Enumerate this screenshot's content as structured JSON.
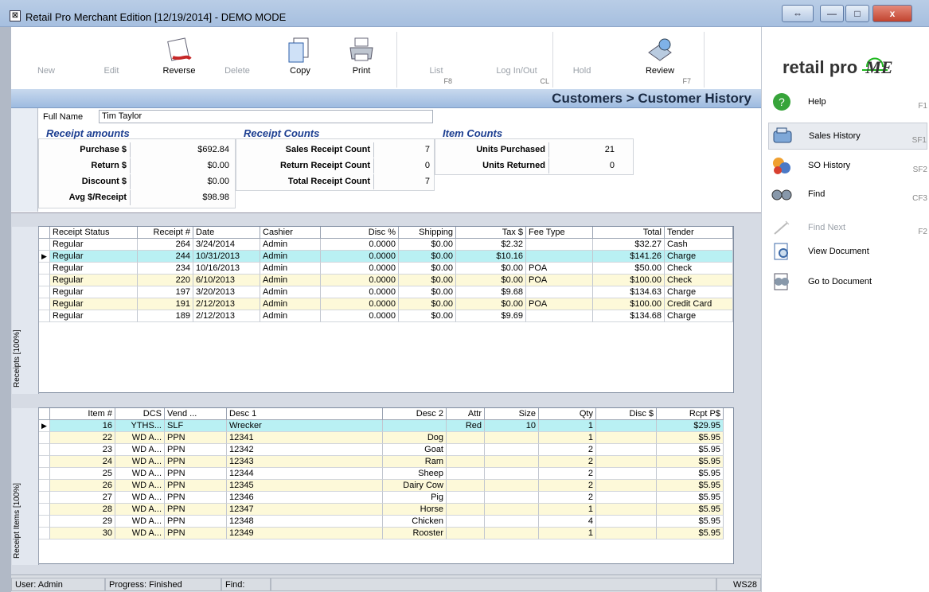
{
  "window": {
    "title": "Retail Pro Merchant Edition [12/19/2014] - DEMO MODE",
    "controls": [
      "⇔",
      "—",
      "□",
      "x"
    ]
  },
  "toolbar": [
    {
      "label": "New",
      "enabled": false,
      "fkey": ""
    },
    {
      "label": "Edit",
      "enabled": false,
      "fkey": ""
    },
    {
      "label": "Reverse",
      "enabled": true,
      "fkey": ""
    },
    {
      "label": "Delete",
      "enabled": false,
      "fkey": ""
    },
    {
      "label": "Copy",
      "enabled": true,
      "fkey": ""
    },
    {
      "label": "Print",
      "enabled": true,
      "fkey": ""
    },
    {
      "label": "List",
      "enabled": false,
      "fkey": "F8"
    },
    {
      "label": "Log In/Out",
      "enabled": false,
      "fkey": "CL"
    },
    {
      "label": "Hold",
      "enabled": false,
      "fkey": ""
    },
    {
      "label": "Review",
      "enabled": true,
      "fkey": "F7"
    }
  ],
  "logo": {
    "text": "retail pro",
    "suffix": "ME"
  },
  "breadcrumb": "Customers > Customer History",
  "customer": {
    "label": "Full Name",
    "value": "Tim Taylor"
  },
  "receipt_amounts": {
    "title": "Receipt amounts",
    "rows": [
      {
        "label": "Purchase $",
        "value": "$692.84"
      },
      {
        "label": "Return $",
        "value": "$0.00"
      },
      {
        "label": "Discount $",
        "value": "$0.00"
      },
      {
        "label": "Avg $/Receipt",
        "value": "$98.98"
      }
    ]
  },
  "receipt_counts": {
    "title": "Receipt Counts",
    "rows": [
      {
        "label": "Sales Receipt Count",
        "value": "7"
      },
      {
        "label": "Return Receipt Count",
        "value": "0"
      },
      {
        "label": "Total Receipt Count",
        "value": "7"
      }
    ]
  },
  "item_counts": {
    "title": "Item Counts",
    "rows": [
      {
        "label": "Units Purchased",
        "value": "21"
      },
      {
        "label": "Units Returned",
        "value": "0"
      }
    ]
  },
  "receipts": {
    "tab": "Receipts [100%]",
    "columns": [
      "Receipt Status",
      "Receipt #",
      "Date",
      "Cashier",
      "Disc %",
      "Shipping",
      "Tax $",
      "Fee Type",
      "Total",
      "Tender"
    ],
    "rows": [
      [
        "Regular",
        "264",
        "3/24/2014",
        "Admin",
        "0.0000",
        "$0.00",
        "$2.32",
        "",
        "$32.27",
        "Cash"
      ],
      [
        "Regular",
        "244",
        "10/31/2013",
        "Admin",
        "0.0000",
        "$0.00",
        "$10.16",
        "",
        "$141.26",
        "Charge"
      ],
      [
        "Regular",
        "234",
        "10/16/2013",
        "Admin",
        "0.0000",
        "$0.00",
        "$0.00",
        "POA",
        "$50.00",
        "Check"
      ],
      [
        "Regular",
        "220",
        "6/10/2013",
        "Admin",
        "0.0000",
        "$0.00",
        "$0.00",
        "POA",
        "$100.00",
        "Check"
      ],
      [
        "Regular",
        "197",
        "3/20/2013",
        "Admin",
        "0.0000",
        "$0.00",
        "$9.68",
        "",
        "$134.63",
        "Charge"
      ],
      [
        "Regular",
        "191",
        "2/12/2013",
        "Admin",
        "0.0000",
        "$0.00",
        "$0.00",
        "POA",
        "$100.00",
        "Credit Card"
      ],
      [
        "Regular",
        "189",
        "2/12/2013",
        "Admin",
        "0.0000",
        "$0.00",
        "$9.69",
        "",
        "$134.68",
        "Charge"
      ]
    ],
    "selected": 1
  },
  "items": {
    "tab": "Receipt Items [100%]",
    "columns": [
      "Item #",
      "DCS",
      "Vend ...",
      "Desc 1",
      "Desc 2",
      "Attr",
      "Size",
      "Qty",
      "Disc $",
      "Rcpt P$"
    ],
    "rows": [
      [
        "16",
        "YTHS...",
        "SLF",
        "Wrecker",
        "",
        "Red",
        "10",
        "1",
        "",
        "$29.95"
      ],
      [
        "22",
        "WD A...",
        "PPN",
        "12341",
        "Dog",
        "",
        "",
        "1",
        "",
        "$5.95"
      ],
      [
        "23",
        "WD A...",
        "PPN",
        "12342",
        "Goat",
        "",
        "",
        "2",
        "",
        "$5.95"
      ],
      [
        "24",
        "WD A...",
        "PPN",
        "12343",
        "Ram",
        "",
        "",
        "2",
        "",
        "$5.95"
      ],
      [
        "25",
        "WD A...",
        "PPN",
        "12344",
        "Sheep",
        "",
        "",
        "2",
        "",
        "$5.95"
      ],
      [
        "26",
        "WD A...",
        "PPN",
        "12345",
        "Dairy Cow",
        "",
        "",
        "2",
        "",
        "$5.95"
      ],
      [
        "27",
        "WD A...",
        "PPN",
        "12346",
        "Pig",
        "",
        "",
        "2",
        "",
        "$5.95"
      ],
      [
        "28",
        "WD A...",
        "PPN",
        "12347",
        "Horse",
        "",
        "",
        "1",
        "",
        "$5.95"
      ],
      [
        "29",
        "WD A...",
        "PPN",
        "12348",
        "Chicken",
        "",
        "",
        "4",
        "",
        "$5.95"
      ],
      [
        "30",
        "WD A...",
        "PPN",
        "12349",
        "Rooster",
        "",
        "",
        "1",
        "",
        "$5.95"
      ]
    ],
    "selected": 0
  },
  "sidebar": [
    {
      "label": "Help",
      "key": "F1",
      "icon": "help-icon",
      "enabled": true
    },
    {
      "label": "Sales History",
      "key": "SF1",
      "icon": "sales-history-icon",
      "enabled": true
    },
    {
      "label": "SO History",
      "key": "SF2",
      "icon": "so-history-icon",
      "enabled": true
    },
    {
      "label": "Find",
      "key": "CF3",
      "icon": "binoculars-icon",
      "enabled": true
    },
    {
      "label": "Find Next",
      "key": "F2",
      "icon": "find-next-icon",
      "enabled": false
    },
    {
      "label": "View Document",
      "key": "",
      "icon": "view-document-icon",
      "enabled": true
    },
    {
      "label": "Go to Document",
      "key": "",
      "icon": "go-to-document-icon",
      "enabled": true
    }
  ],
  "status": {
    "user": "User: Admin",
    "progress": "Progress: Finished",
    "find": "Find:",
    "station": "WS28"
  },
  "colors": {
    "alt_row": "#fdf9d9",
    "selected_row": "#b9f0f3",
    "logo_green": "#1eb81e",
    "heading_blue": "#1d3f91"
  }
}
